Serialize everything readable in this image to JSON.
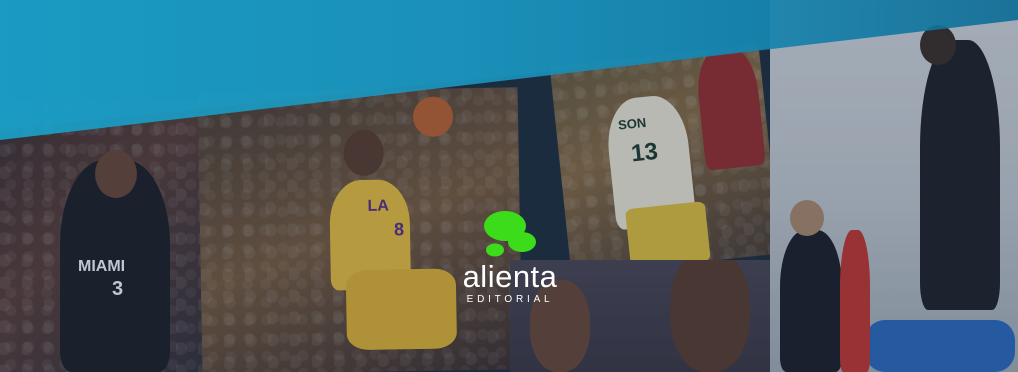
{
  "logo": {
    "brand_name": "alienta",
    "subtitle": "EDITORIAL",
    "mark_color": "#3ddc1a"
  },
  "photo_texts": {
    "miami_jersey": "MIAMI",
    "miami_number": "3",
    "lakers_jersey": "LA",
    "lakers_number": "8",
    "pacers_jersey": "SON",
    "pacers_number": "13"
  },
  "colors": {
    "teal_band": "#1a9cc5",
    "overlay": "#1e3250"
  }
}
